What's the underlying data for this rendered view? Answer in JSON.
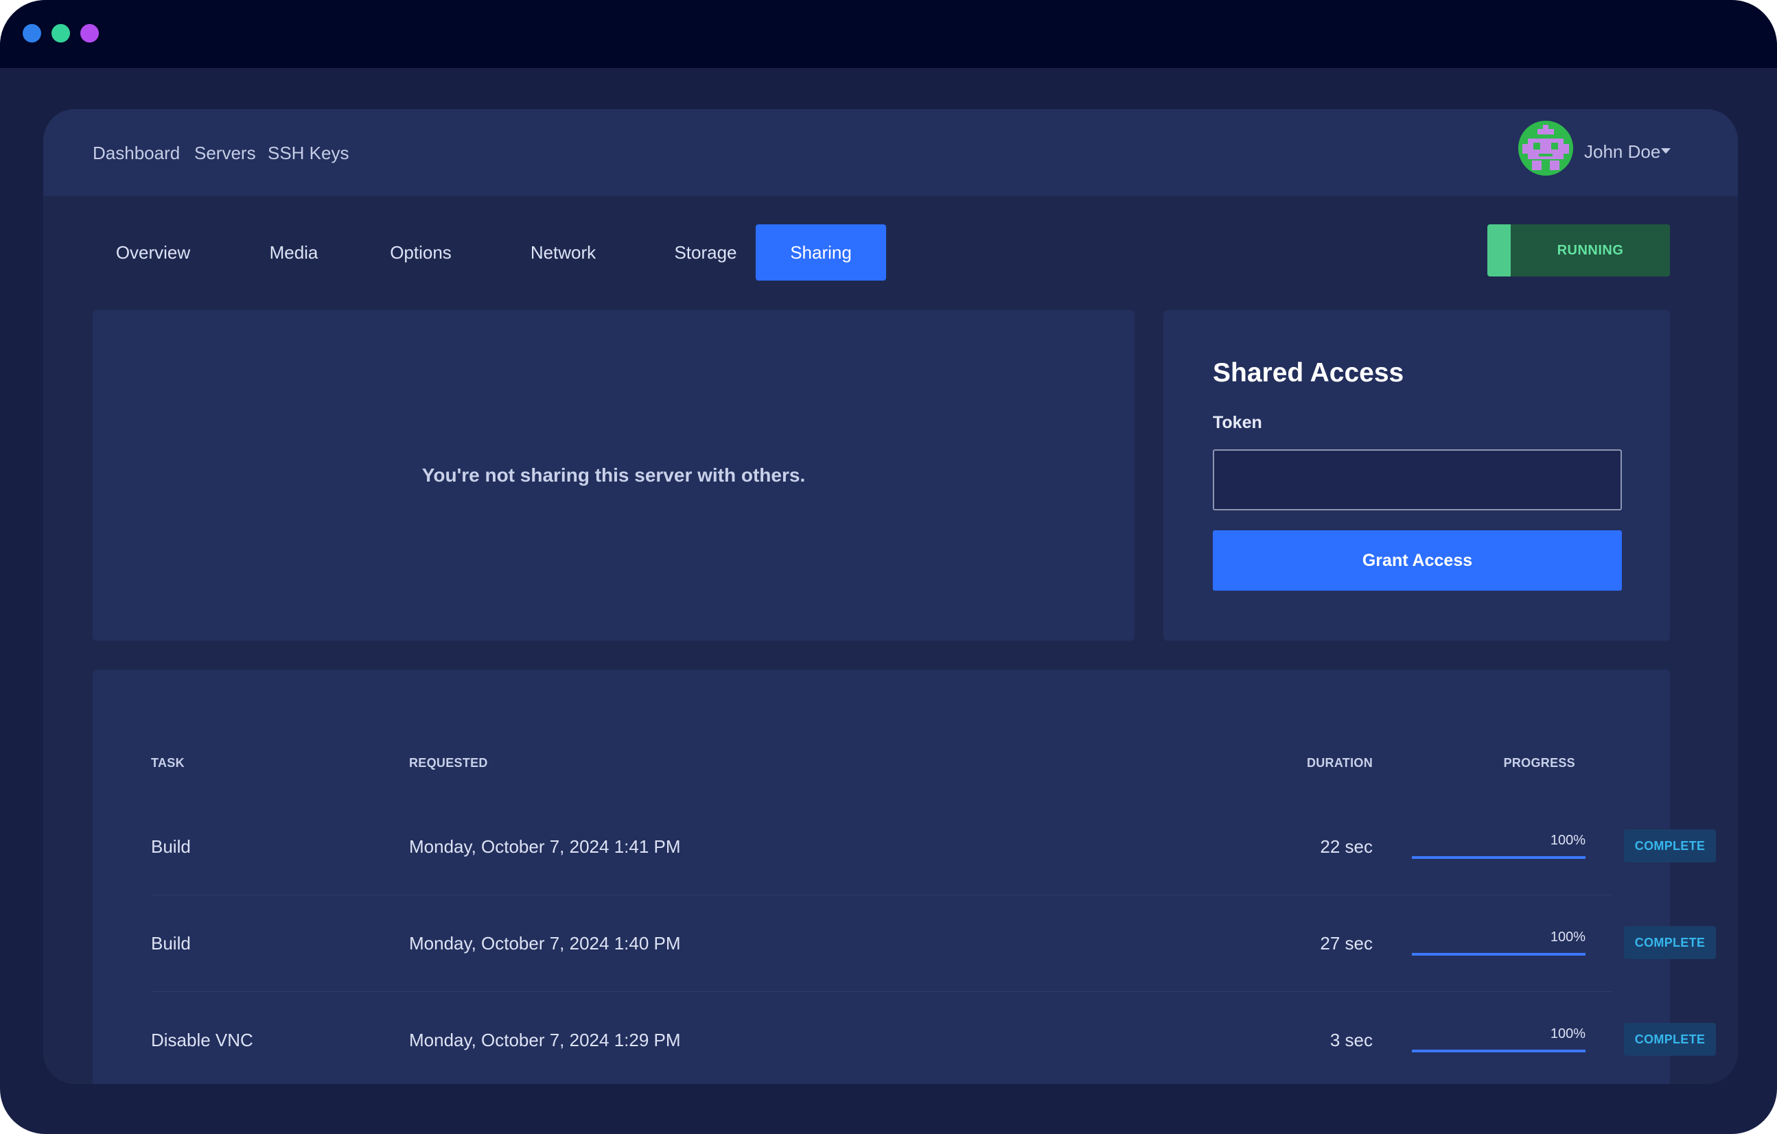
{
  "colors": {
    "window_bg": "#181f45",
    "titlebar_bg": "#000627",
    "dot_blue": "#2f80ed",
    "dot_green": "#34d399",
    "dot_purple": "#b24cf0",
    "accent": "#2d6fff",
    "running_strip": "#4ecb8a",
    "running_text": "#63e2a0",
    "complete_text": "#36b7ec"
  },
  "nav": {
    "links": [
      "Dashboard",
      "Servers",
      "SSH Keys"
    ],
    "user_name": "John Doe"
  },
  "tabs": [
    {
      "label": "Overview",
      "active": false
    },
    {
      "label": "Media",
      "active": false
    },
    {
      "label": "Options",
      "active": false
    },
    {
      "label": "Network",
      "active": false
    },
    {
      "label": "Storage",
      "active": false
    },
    {
      "label": "Sharing",
      "active": true
    }
  ],
  "status": {
    "label": "RUNNING"
  },
  "sharing": {
    "empty_message": "You're not sharing this server with others."
  },
  "shared_access": {
    "title": "Shared Access",
    "token_label": "Token",
    "token_value": "",
    "grant_label": "Grant Access"
  },
  "tasks": {
    "headers": {
      "task": "TASK",
      "requested": "REQUESTED",
      "duration": "DURATION",
      "progress": "PROGRESS"
    },
    "rows": [
      {
        "task": "Build",
        "requested": "Monday, October 7, 2024 1:41 PM",
        "duration": "22 sec",
        "progress_label": "100%",
        "progress": 1.0,
        "status": "COMPLETE"
      },
      {
        "task": "Build",
        "requested": "Monday, October 7, 2024 1:40 PM",
        "duration": "27 sec",
        "progress_label": "100%",
        "progress": 1.0,
        "status": "COMPLETE"
      },
      {
        "task": "Disable VNC",
        "requested": "Monday, October 7, 2024 1:29 PM",
        "duration": "3 sec",
        "progress_label": "100%",
        "progress": 1.0,
        "status": "COMPLETE"
      }
    ]
  }
}
